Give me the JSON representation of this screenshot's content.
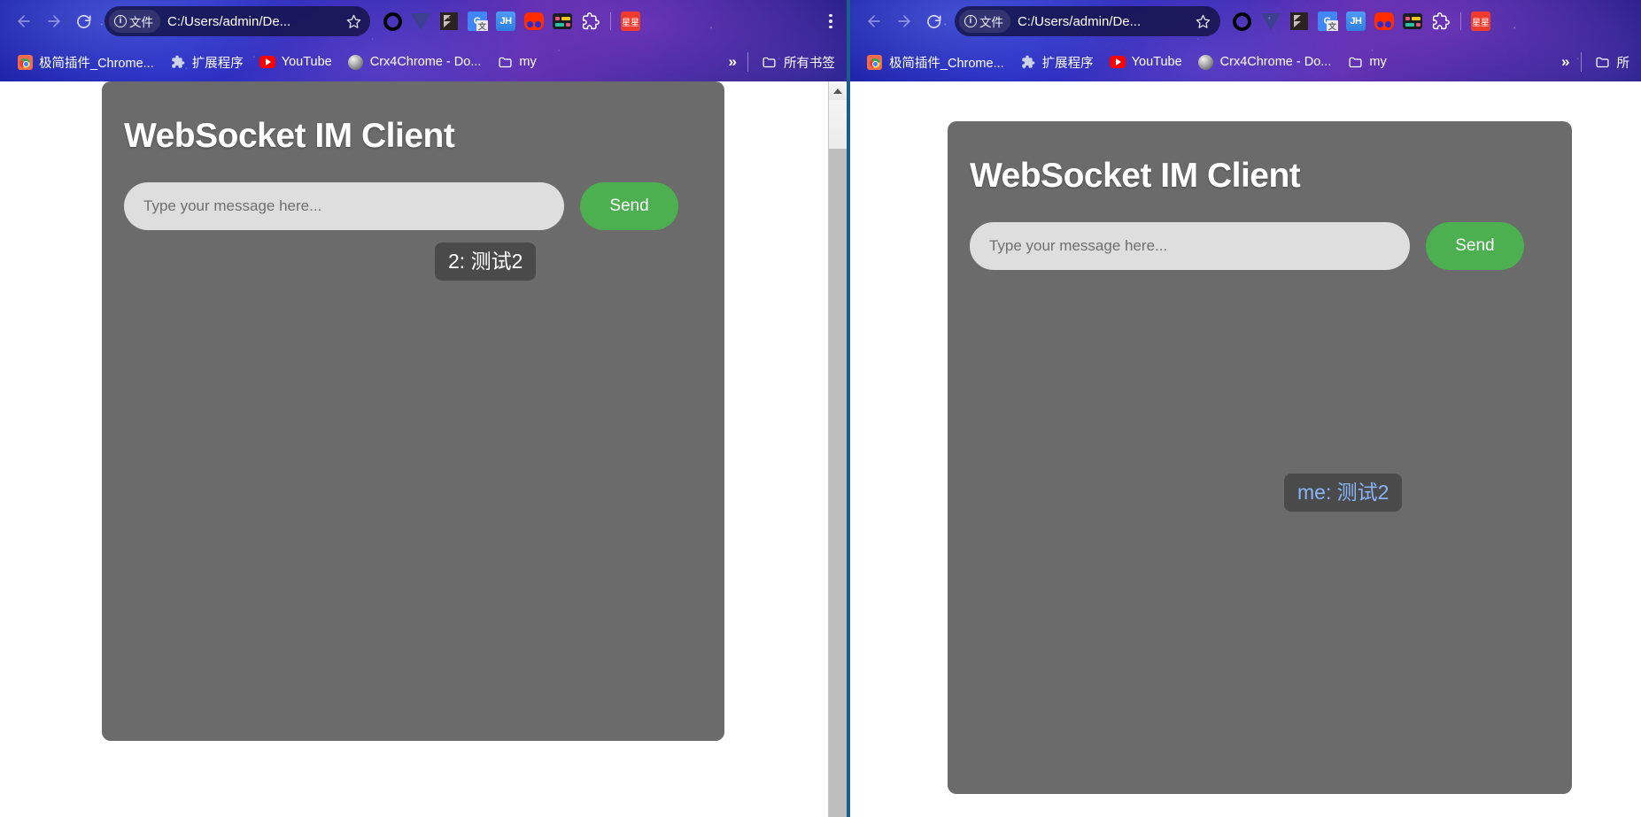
{
  "windows": [
    {
      "id": "left",
      "browser": {
        "nav": {
          "back": "back-arrow",
          "forward": "forward-arrow",
          "reload": "reload-arrow"
        },
        "omnibox": {
          "site_chip_label": "文件",
          "url": "C:/Users/admin/De...",
          "star": "☆"
        },
        "extensions": [
          {
            "name": "opera-extension-icon",
            "label": ""
          },
          {
            "name": "vue-devtools-icon",
            "label": ""
          },
          {
            "name": "dark-reader-icon",
            "label": ""
          },
          {
            "name": "google-translate-icon",
            "label": "G"
          },
          {
            "name": "jh-extension-icon",
            "label": "JH"
          },
          {
            "name": "red-extension-icon",
            "label": ""
          },
          {
            "name": "shortcut-keys-icon",
            "label": ""
          },
          {
            "name": "extensions-puzzle-icon",
            "label": ""
          },
          {
            "name": "xingxing-extension-icon",
            "label": "星星"
          }
        ],
        "menu": "chrome-menu-kebab",
        "bookmarks": [
          {
            "label": "极简插件_Chrome...",
            "icon": "chrome-store-icon"
          },
          {
            "label": "扩展程序",
            "icon": "puzzle-icon"
          },
          {
            "label": "YouTube",
            "icon": "youtube-icon"
          },
          {
            "label": "Crx4Chrome - Do...",
            "icon": "globe-icon"
          },
          {
            "label": "my",
            "icon": "folder-icon"
          }
        ],
        "bookmarks_overflow": "»",
        "all_bookmarks_label": "所有书签"
      },
      "app": {
        "title": "WebSocket IM Client",
        "input_placeholder": "Type your message here...",
        "input_value": "",
        "send_label": "Send",
        "messages": [
          {
            "text": "2: 测试2",
            "color": "#ffffff"
          }
        ]
      },
      "scrollbar": {
        "up_arrow": "▲"
      }
    },
    {
      "id": "right",
      "browser": {
        "omnibox": {
          "site_chip_label": "文件",
          "url": "C:/Users/admin/De...",
          "star": "☆"
        },
        "extensions": [
          {
            "name": "opera-extension-icon",
            "label": ""
          },
          {
            "name": "vue-devtools-icon",
            "label": ""
          },
          {
            "name": "dark-reader-icon",
            "label": ""
          },
          {
            "name": "google-translate-icon",
            "label": "G"
          },
          {
            "name": "jh-extension-icon",
            "label": "JH"
          },
          {
            "name": "red-extension-icon",
            "label": ""
          },
          {
            "name": "shortcut-keys-icon",
            "label": ""
          },
          {
            "name": "extensions-puzzle-icon",
            "label": ""
          },
          {
            "name": "xingxing-extension-icon",
            "label": "星星"
          }
        ],
        "bookmarks": [
          {
            "label": "极简插件_Chrome...",
            "icon": "chrome-store-icon"
          },
          {
            "label": "扩展程序",
            "icon": "puzzle-icon"
          },
          {
            "label": "YouTube",
            "icon": "youtube-icon"
          },
          {
            "label": "Crx4Chrome - Do...",
            "icon": "globe-icon"
          },
          {
            "label": "my",
            "icon": "folder-icon"
          }
        ],
        "bookmarks_overflow": "»",
        "all_bookmarks_label": "所"
      },
      "app": {
        "title": "WebSocket IM Client",
        "input_placeholder": "Type your message here...",
        "input_value": "",
        "send_label": "Send",
        "messages": [
          {
            "text": "me: 测试2",
            "color": "#8ab4f8"
          }
        ]
      }
    }
  ],
  "theme": {
    "card_bg": "#6b6b6b",
    "send_button": "#4caf50",
    "input_bg": "#dedede",
    "bubble_bg": "#4a4a4a",
    "bubble_text_left": "#ffffff",
    "bubble_text_right": "#8ab4f8",
    "chrome_accent": "#2a2fc4"
  }
}
